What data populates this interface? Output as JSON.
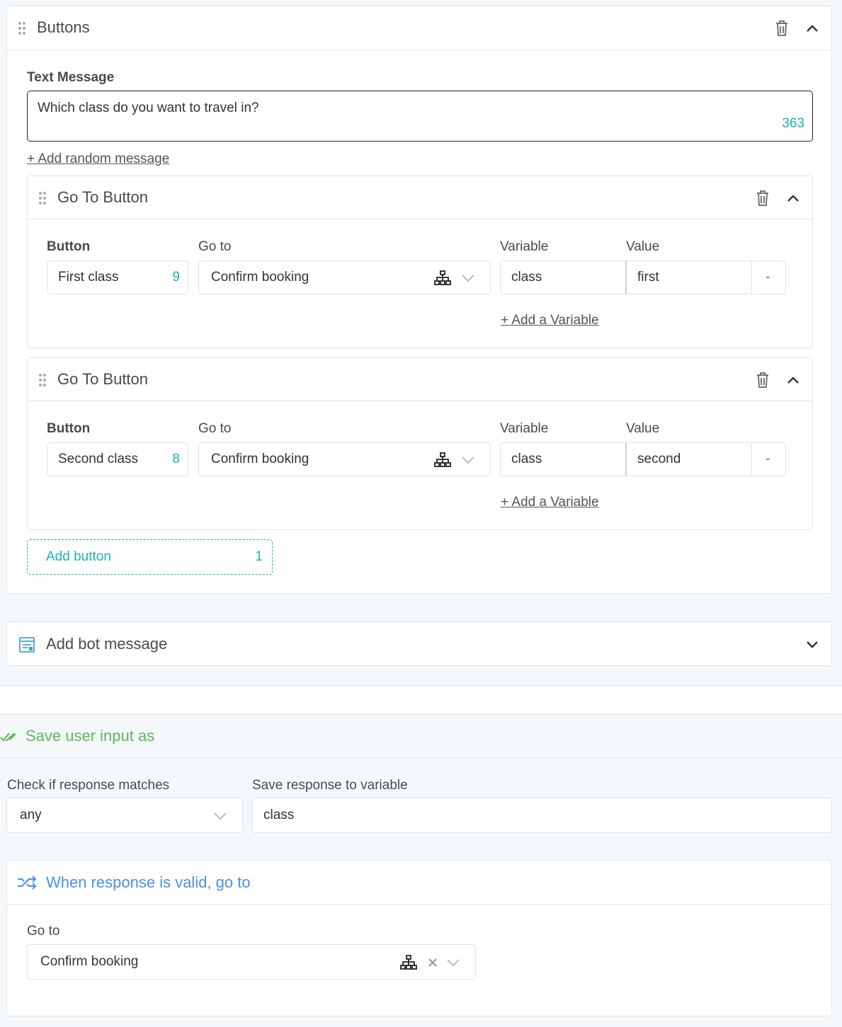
{
  "buttons_card": {
    "title": "Buttons",
    "text_message_label": "Text Message",
    "text_message_value": "Which class do you want to travel in?",
    "char_count": "363",
    "add_random_link": "+ Add random message"
  },
  "goto_buttons": [
    {
      "title": "Go To Button",
      "button_label": "Button",
      "goto_label": "Go to",
      "variable_label": "Variable",
      "value_label": "Value",
      "button_text": "First class",
      "button_count": "9",
      "goto_value": "Confirm booking",
      "variable": "class",
      "value": "first",
      "remove": "-",
      "add_variable": "+ Add a Variable"
    },
    {
      "title": "Go To Button",
      "button_label": "Button",
      "goto_label": "Go to",
      "variable_label": "Variable",
      "value_label": "Value",
      "button_text": "Second class",
      "button_count": "8",
      "goto_value": "Confirm booking",
      "variable": "class",
      "value": "second",
      "remove": "-",
      "add_variable": "+ Add a Variable"
    }
  ],
  "add_button": {
    "label": "Add button",
    "count": "1"
  },
  "add_bot_message": {
    "label": "Add bot message"
  },
  "save_input": {
    "title": "Save user input as",
    "match_label": "Check if response matches",
    "match_value": "any",
    "variable_label": "Save response to variable",
    "variable_value": "class"
  },
  "valid_response": {
    "title": "When response is valid, go to",
    "goto_label": "Go to",
    "goto_value": "Confirm booking"
  },
  "colors": {
    "teal": "#19b4b4",
    "green": "#5cb85c",
    "blue": "#4a90e2"
  }
}
